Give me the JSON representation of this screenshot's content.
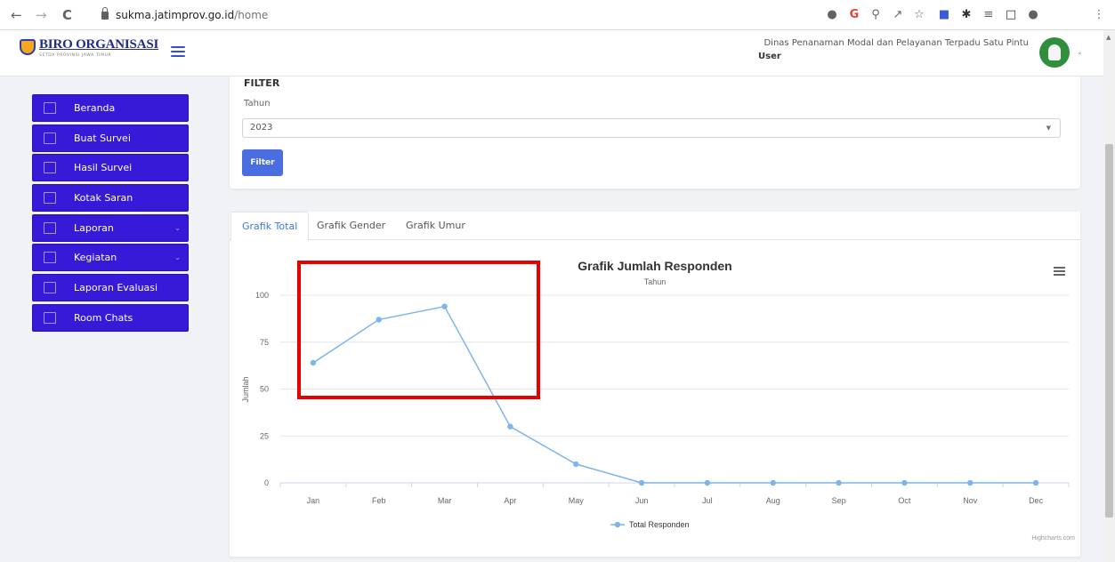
{
  "browser": {
    "url_host": "sukma.jatimprov.go.id",
    "url_path": "/home",
    "back_glyph": "←",
    "forward_glyph": "→",
    "reload_glyph": "C",
    "icons": [
      "location-icon",
      "google-icon",
      "zoom-icon",
      "share-icon",
      "bookmark-star-icon",
      "extension-icon",
      "puzzle-icon",
      "playlist-icon",
      "sidepanel-icon",
      "profile-icon",
      "menu-dots-icon"
    ]
  },
  "header": {
    "brand_title": "BIRO ORGANISASI",
    "brand_subtitle": "SETDA PROVINSI JAWA TIMUR",
    "org_name": "Dinas Penanaman Modal dan Pelayanan Terpadu Satu Pintu",
    "user_label": "User"
  },
  "sidebar": {
    "items": [
      {
        "label": "Beranda",
        "icon": "home-icon",
        "has_children": false
      },
      {
        "label": "Buat Survei",
        "icon": "folder-icon",
        "has_children": false
      },
      {
        "label": "Hasil Survei",
        "icon": "clipboard-icon",
        "has_children": false
      },
      {
        "label": "Kotak Saran",
        "icon": "inbox-icon",
        "has_children": false
      },
      {
        "label": "Laporan",
        "icon": "report-icon",
        "has_children": true
      },
      {
        "label": "Kegiatan",
        "icon": "calendar-icon",
        "has_children": true
      },
      {
        "label": "Laporan Evaluasi",
        "icon": "document-icon",
        "has_children": false
      },
      {
        "label": "Room Chats",
        "icon": "chat-icon",
        "has_children": false
      }
    ]
  },
  "filter": {
    "heading": "FILTER",
    "year_label": "Tahun",
    "year_value": "2023",
    "button_label": "Filter",
    "button_color": "#4a6ee0"
  },
  "tabs": [
    {
      "label": "Grafik Total",
      "active": true
    },
    {
      "label": "Grafik Gender",
      "active": false
    },
    {
      "label": "Grafik Umur",
      "active": false
    }
  ],
  "chart_data": {
    "type": "line",
    "title": "Grafik Jumlah Responden",
    "subtitle": "Tahun",
    "xlabel": "",
    "ylabel": "Jumlah",
    "categories": [
      "Jan",
      "Feb",
      "Mar",
      "Apr",
      "May",
      "Jun",
      "Jul",
      "Aug",
      "Sep",
      "Oct",
      "Nov",
      "Dec"
    ],
    "series": [
      {
        "name": "Total Responden",
        "values": [
          64,
          87,
          94,
          30,
          10,
          0,
          0,
          0,
          0,
          0,
          0,
          0
        ],
        "color": "#7cb5ec"
      }
    ],
    "ylim": [
      0,
      100
    ],
    "yticks": [
      0,
      25,
      50,
      75,
      100
    ],
    "grid": true,
    "legend": "bottom-center",
    "credits": "Highcharts.com"
  },
  "colors": {
    "sidebar_bg": "#3719d8",
    "active_tab": "#3a7bd5",
    "highlight_box": "#e60000"
  }
}
